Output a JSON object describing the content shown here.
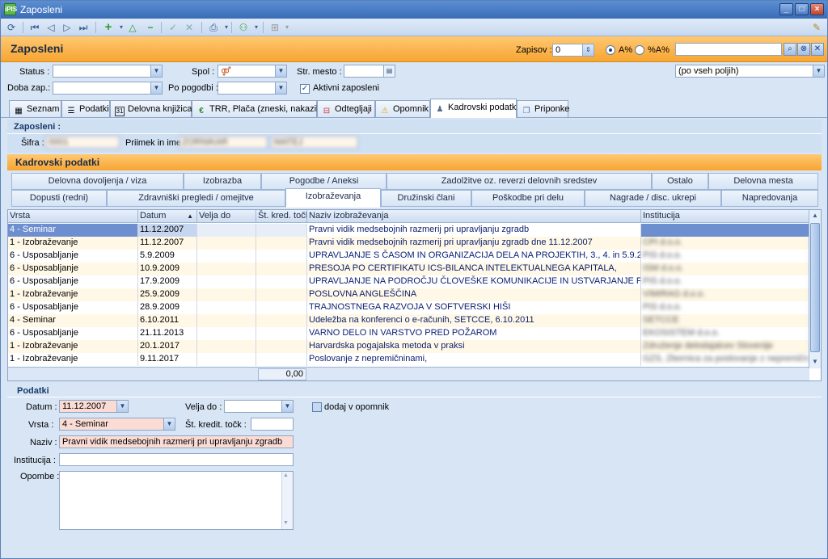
{
  "window": {
    "title": "Zaposleni",
    "app_icon": "pis-app-icon"
  },
  "header": {
    "title": "Zaposleni",
    "zapisov_label": "Zapisov :",
    "zapisov_value": "0",
    "radio_a_label": "A%",
    "radio_b_label": "%A%",
    "search_value": "",
    "field_select": "(po vseh poljih)"
  },
  "filters": {
    "status_label": "Status :",
    "spol_label": "Spol :",
    "str_mesto_label": "Str. mesto :",
    "doba_label": "Doba zap.:",
    "po_pogodbi_label": "Po pogodbi :",
    "aktivni_label": "Aktivni zaposleni"
  },
  "tabs": [
    {
      "label": "Seznam",
      "icon": "grid-icon"
    },
    {
      "label": "Podatki",
      "icon": "list-icon"
    },
    {
      "label": "Delovna knjižica",
      "icon": "calendar-icon"
    },
    {
      "label": "TRR, Plača (zneski, nakazila)",
      "icon": "euro-icon"
    },
    {
      "label": "Odtegljaji",
      "icon": "deduction-icon"
    },
    {
      "label": "Opomnik",
      "icon": "warning-icon"
    },
    {
      "label": "Kadrovski podatki",
      "icon": "person-icon"
    },
    {
      "label": "Priponke",
      "icon": "attachment-icon"
    }
  ],
  "employee": {
    "section_title": "Zaposleni :",
    "sifra_label": "Šifra :",
    "sifra_value": "0001",
    "priimek_label": "Priimek in ime :",
    "priimek_value": "ZORNIKAR",
    "ime_value": "MATEJ"
  },
  "kadrovski": {
    "title": "Kadrovski podatki",
    "subtabs_row1": [
      "Delovna dovoljenja / viza",
      "Izobrazba",
      "Pogodbe / Aneksi",
      "Zadolžitve oz. reverzi delovnih sredstev",
      "Ostalo",
      "Delovna mesta"
    ],
    "subtabs_row2": [
      "Dopusti (redni)",
      "Zdravniški pregledi / omejitve",
      "Izobraževanja",
      "Družinski člani",
      "Poškodbe pri delu",
      "Nagrade / disc. ukrepi",
      "Napredovanja"
    ]
  },
  "table": {
    "columns": [
      "Vrsta",
      "Datum",
      "Velja do",
      "Št. kred. točk",
      "Naziv izobraževanja",
      "Institucija"
    ],
    "rows": [
      [
        "4 - Seminar",
        "11.12.2007",
        "",
        "",
        "Pravni vidik medsebojnih razmerij pri upravljanju zgradb",
        ""
      ],
      [
        "1 - Izobraževanje",
        "11.12.2007",
        "",
        "",
        "Pravni vidik medsebojnih razmerij pri upravljanju zgradb dne 11.12.2007",
        "CPI d.o.o."
      ],
      [
        "6 - Usposabljanje",
        "5.9.2009",
        "",
        "",
        "UPRAVLJANJE S ČASOM IN ORGANIZACIJA DELA NA PROJEKTIH, 3., 4. in 5.9.2009",
        "PIS d.o.o."
      ],
      [
        "6 - Usposabljanje",
        "10.9.2009",
        "",
        "",
        "PRESOJA  PO CERTIFIKATU ICS-BILANCA INTELEKTUALNEGA KAPITALA,",
        "ISM d.o.o."
      ],
      [
        "6 - Usposabljanje",
        "17.9.2009",
        "",
        "",
        "UPRAVLJANJE NA PODROČJU ČLOVEŠKE KOMUNIKACIJE IN USTVARJANJE POZITIVNE KLIME,",
        "PIS d.o.o."
      ],
      [
        "1 - Izobraževanje",
        "25.9.2009",
        "",
        "",
        "POSLOVNA ANGLEŠČINA",
        "VIMIRAG d.o.o."
      ],
      [
        "6 - Usposabljanje",
        "28.9.2009",
        "",
        "",
        "TRAJNOSTNEGA RAZVOJA V SOFTVERSKI HIŠI",
        "PIS d.o.o."
      ],
      [
        "4 - Seminar",
        "6.10.2011",
        "",
        "",
        "Udeležba na konferenci o e-računih, SETCCE, 6.10.2011",
        "SETCCE"
      ],
      [
        "6 - Usposabljanje",
        "21.11.2013",
        "",
        "",
        "VARNO DELO IN VARSTVO PRED POŽAROM",
        "EKOSISTEM d.o.o."
      ],
      [
        "1 - Izobraževanje",
        "20.1.2017",
        "",
        "",
        "Harvardska pogajalska metoda v praksi",
        "Združenje delodajalcev Slovenije"
      ],
      [
        "1 - Izobraževanje",
        "9.11.2017",
        "",
        "",
        "Poslovanje z nepremičninami,",
        "GZS, Zbornica za poslovanje z nepremičninami"
      ]
    ],
    "footer_sum": "0,00"
  },
  "podatki": {
    "title": "Podatki",
    "datum_label": "Datum :",
    "datum_value": "11.12.2007",
    "velja_label": "Velja do :",
    "velja_value": "",
    "opomnik_label": "dodaj v opomnik",
    "vrsta_label": "Vrsta :",
    "vrsta_value": "4 - Seminar",
    "kred_label": "Št. kredit. točk :",
    "kred_value": "",
    "naziv_label": "Naziv :",
    "naziv_value": "Pravni vidik medsebojnih razmerij pri upravljanju zgradb",
    "inst_label": "Institucija :",
    "inst_value": "",
    "opombe_label": "Opombe :",
    "opombe_value": ""
  },
  "colors": {
    "accent_orange": "#f7a531",
    "selected_row": "#6e8fcf",
    "row_alt": "#fff8e6",
    "required_field": "#fbdcd5"
  }
}
